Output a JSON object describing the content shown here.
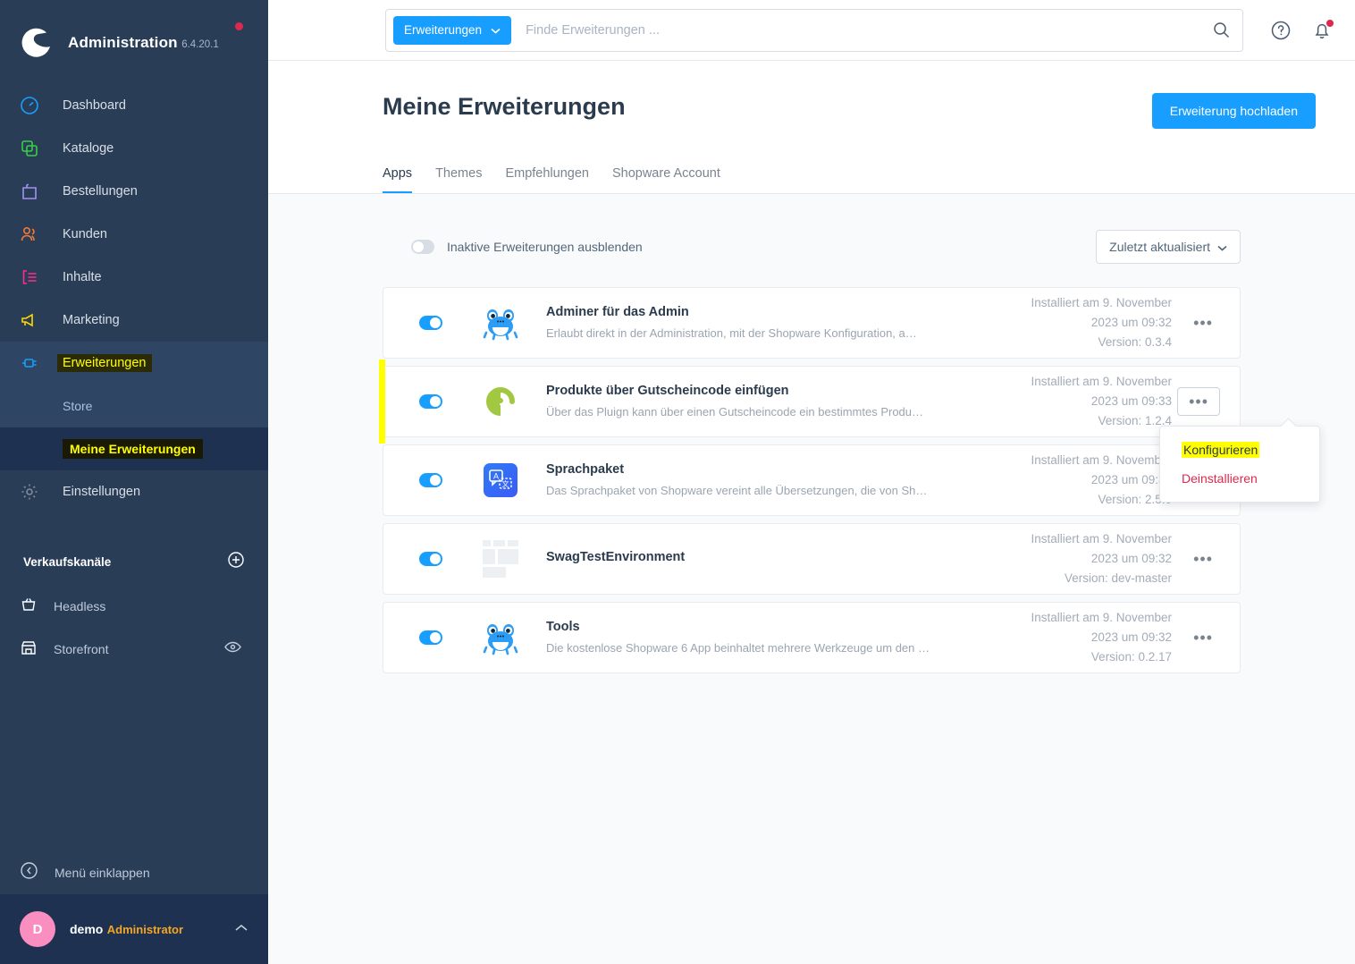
{
  "sidebar": {
    "brand": {
      "title": "Administration",
      "version": "6.4.20.1",
      "logo_icon": "shopware-logo-icon",
      "status_dot": "notification-dot"
    },
    "items": [
      {
        "label": "Dashboard",
        "icon": "dashboard-icon",
        "color": "#189EFF"
      },
      {
        "label": "Kataloge",
        "icon": "catalog-icon",
        "color": "#37D046"
      },
      {
        "label": "Bestellungen",
        "icon": "orders-bag-icon",
        "color": "#A092F0"
      },
      {
        "label": "Kunden",
        "icon": "customers-icon",
        "color": "#EE7A34"
      },
      {
        "label": "Inhalte",
        "icon": "content-icon",
        "color": "#FF2D87"
      },
      {
        "label": "Marketing",
        "icon": "megaphone-icon",
        "color": "#FFD700"
      },
      {
        "label": "Erweiterungen",
        "icon": "plugin-plug-icon",
        "color": "#189EFF"
      }
    ],
    "sub_items": [
      {
        "label": "Store",
        "active": false
      },
      {
        "label": "Meine Erweiterungen",
        "active": true
      }
    ],
    "settings": {
      "label": "Einstellungen",
      "icon": "gear-icon"
    },
    "sales_channels": {
      "title": "Verkaufskanäle",
      "add_icon": "plus-circle-icon",
      "items": [
        {
          "label": "Headless",
          "icon": "basket-icon"
        },
        {
          "label": "Storefront",
          "icon": "storefront-icon",
          "trailing_icon": "eye-icon"
        }
      ]
    },
    "collapse": {
      "label": "Menü einklappen",
      "icon": "chevron-left-circle-icon"
    },
    "user": {
      "initial": "D",
      "name": "demo",
      "role": "Administrator",
      "caret_icon": "chevron-up-icon"
    }
  },
  "topbar": {
    "scope_button": "Erweiterungen",
    "scope_caret_icon": "chevron-down-icon",
    "search_placeholder": "Finde Erweiterungen ...",
    "search_value": "",
    "search_icon": "search-icon",
    "help_icon": "help-circle-icon",
    "bell_icon": "bell-icon"
  },
  "page": {
    "title": "Meine Erweiterungen",
    "upload_button": "Erweiterung hochladen",
    "tabs": [
      {
        "label": "Apps",
        "active": true
      },
      {
        "label": "Themes",
        "active": false
      },
      {
        "label": "Empfehlungen",
        "active": false
      },
      {
        "label": "Shopware Account",
        "active": false
      }
    ]
  },
  "toolbar": {
    "hide_inactive_label": "Inaktive Erweiterungen ausblenden",
    "hide_inactive_on": false,
    "sort_label": "Zuletzt aktualisiert",
    "sort_caret_icon": "chevron-down-icon"
  },
  "extensions": [
    {
      "name": "Adminer für das Admin",
      "description": "Erlaubt direkt in der Administration, mit der Shopware Konfiguration, a…",
      "installed_line1": "Installiert am 9. November",
      "installed_line2": "2023 um 09:32",
      "version": "Version: 0.3.4",
      "active": true,
      "icon": "frog-app-icon",
      "selected": false,
      "menu_open": false
    },
    {
      "name": "Produkte über Gutscheincode einfügen",
      "description": "Über das Pluign kann über einen Gutscheincode ein bestimmtes Produ…",
      "installed_line1": "Installiert am 9. November",
      "installed_line2": "2023 um 09:33",
      "version": "Version: 1.2.4",
      "active": true,
      "icon": "green-spiral-icon",
      "selected": true,
      "menu_open": true
    },
    {
      "name": "Sprachpaket",
      "description": "Das Sprachpaket von Shopware vereint alle Übersetzungen, die von Sh…",
      "installed_line1": "Installiert am 9. November",
      "installed_line2": "2023 um 09:32",
      "version": "Version: 2.5.0",
      "active": true,
      "icon": "language-pack-icon",
      "selected": false,
      "menu_open": false
    },
    {
      "name": "SwagTestEnvironment",
      "description": "",
      "installed_line1": "Installiert am 9. November",
      "installed_line2": "2023 um 09:32",
      "version": "Version: dev-master",
      "active": true,
      "icon": "placeholder-thumb-icon",
      "selected": false,
      "menu_open": false
    },
    {
      "name": "Tools",
      "description": "Die kostenlose Shopware 6 App beinhaltet mehrere Werkzeuge um den …",
      "installed_line1": "Installiert am 9. November",
      "installed_line2": "2023 um 09:32",
      "version": "Version: 0.2.17",
      "active": true,
      "icon": "frog-app-icon",
      "selected": false,
      "menu_open": false
    }
  ],
  "context_menu": {
    "configure_label": "Konfigurieren",
    "uninstall_label": "Deinstallieren"
  },
  "colors": {
    "accent": "#189EFF",
    "sidebar_bg": "#2A3D57",
    "sidebar_active_bg": "#1E3150",
    "highlight": "#ffff00",
    "danger": "#DE294C",
    "page_bg": "#F9FAFB"
  }
}
